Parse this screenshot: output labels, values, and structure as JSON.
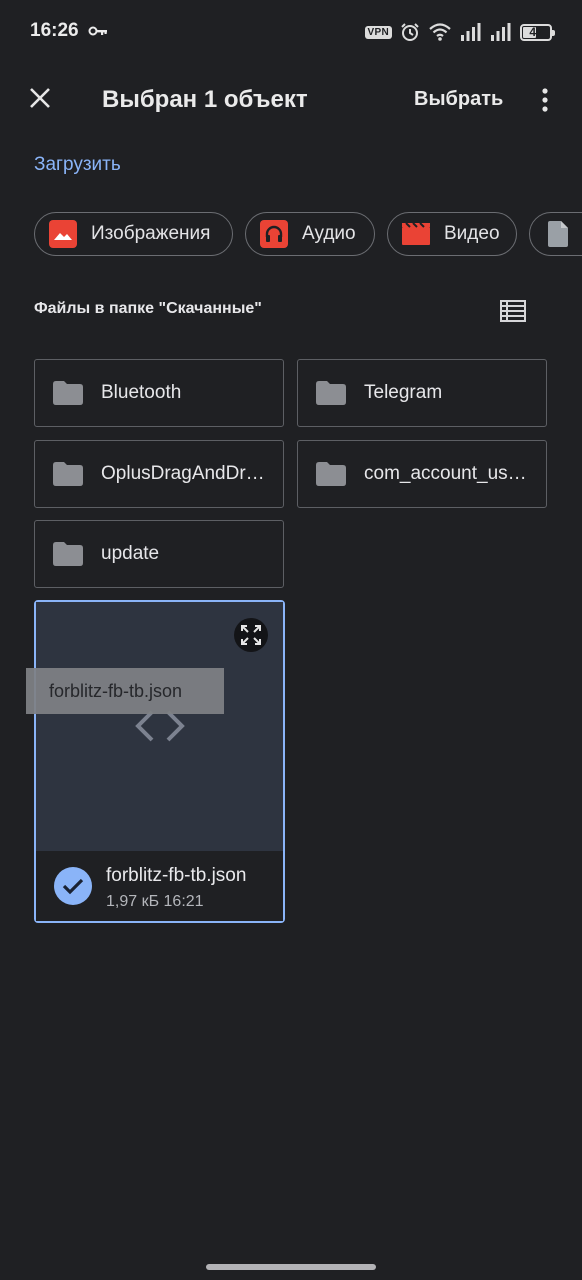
{
  "status_bar": {
    "time": "16:26",
    "vpn": "VPN",
    "battery": "48",
    "battery_level": 0.48
  },
  "app_bar": {
    "title": "Выбран 1 объект",
    "select_label": "Выбрать"
  },
  "upload_label": "Загрузить",
  "chips": [
    {
      "label": "Изображения",
      "icon": "image-icon",
      "color": "#ea4335"
    },
    {
      "label": "Аудио",
      "icon": "headphones-icon",
      "color": "#ea4335"
    },
    {
      "label": "Видео",
      "icon": "video-icon",
      "color": "#ea4335"
    },
    {
      "label": "",
      "icon": "document-icon",
      "color": "#9aa0a6"
    }
  ],
  "section_title": "Файлы в папке \"Скачанные\"",
  "folders": [
    {
      "label": "Bluetooth"
    },
    {
      "label": "Telegram"
    },
    {
      "label": "OplusDragAndDrop"
    },
    {
      "label": "com_account_usage"
    },
    {
      "label": "update"
    }
  ],
  "file": {
    "name": "forblitz-fb-tb.json",
    "meta": "1,97 кБ 16:21",
    "selected": true,
    "tooltip": "forblitz-fb-tb.json"
  },
  "colors": {
    "background": "#1f2023",
    "accent": "#8ab4f8",
    "chip_icon_red": "#ea4335",
    "preview_bg": "#2e3440"
  }
}
